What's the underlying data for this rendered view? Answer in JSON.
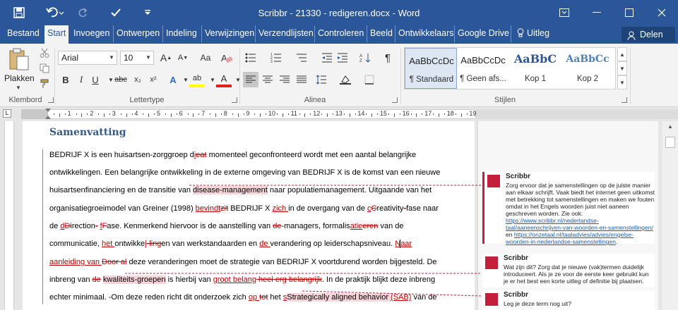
{
  "window": {
    "title": "Scribbr - 21330 - redigeren.docx - Word"
  },
  "tabs": [
    "Bestand",
    "Start",
    "Invoegen",
    "Ontwerpen",
    "Indeling",
    "Verwijzingen",
    "Verzendlijsten",
    "Controleren",
    "Beeld",
    "Ontwikkelaars",
    "Google Drive"
  ],
  "tell_me": "Uitleg",
  "share": "Delen",
  "clipboard": {
    "paste": "Plakken",
    "group": "Klembord"
  },
  "font": {
    "name": "Arial",
    "size": "10",
    "group": "Lettertype",
    "size_up": "A",
    "size_down": "A",
    "case": "Aa",
    "bold": "B",
    "italic": "I",
    "underline": "U",
    "strike": "abc",
    "sub": "x₂",
    "sup": "x²",
    "effects": "A",
    "highlight": "ab",
    "color": "A"
  },
  "paragraph": {
    "group": "Alinea",
    "pilcrow": "¶"
  },
  "styles": {
    "group": "Stijlen",
    "items": [
      {
        "sample": "AaBbCcDc",
        "name": "¶ Standaard"
      },
      {
        "sample": "AaBbCcDc",
        "name": "¶ Geen afs..."
      },
      {
        "sample": "AaBbC",
        "name": "Kop 1"
      },
      {
        "sample": "AaBbCc",
        "name": "Kop 2"
      }
    ]
  },
  "ruler": {
    "labels": [
      "1",
      "2",
      "3",
      "4",
      "5",
      "6",
      "7",
      "8",
      "9",
      "10",
      "11",
      "12",
      "13",
      "14",
      "15",
      "16",
      "17",
      "18",
      "19"
    ]
  },
  "document": {
    "heading": "Samenvatting",
    "lines": [
      [
        {
          "t": "BEDRIJF X is een huisartsen-zorggroep d"
        },
        {
          "t": "i",
          "k": "ins"
        },
        {
          "t": "eat",
          "k": "del"
        },
        {
          "t": " momenteel geconfronteerd wordt met een aantal belangrijke"
        }
      ],
      [
        {
          "t": "ontwikkelingen. Een belangrijke ontwikkeling in de externe omgeving van BEDRIJF X is de komst van een nieuwe"
        }
      ],
      [
        {
          "t": "huisartsenfinanciering en de transitie van "
        },
        {
          "t": "disease-management",
          "k": "hl"
        },
        {
          "t": " naar populatiemanagement. Uitgaande van het"
        }
      ],
      [
        {
          "t": "organisatiegroeimodel van Greiner (1998) "
        },
        {
          "t": "bevindt",
          "k": "ins"
        },
        {
          "t": "zit",
          "k": "del"
        },
        {
          "t": " BEDRIJF X "
        },
        {
          "t": "zich ",
          "k": "ins"
        },
        {
          "t": "in de overgang van de "
        },
        {
          "t": "c",
          "k": "ins"
        },
        {
          "t": "C",
          "k": "del"
        },
        {
          "t": "reativity"
        },
        {
          "t": "-",
          "k": "del"
        },
        {
          "t": "fase naar"
        }
      ],
      [
        {
          "t": "de "
        },
        {
          "t": "d",
          "k": "ins"
        },
        {
          "t": "D",
          "k": "del"
        },
        {
          "t": "irection"
        },
        {
          "t": "-",
          "k": "del"
        },
        {
          "t": " "
        },
        {
          "t": "f",
          "k": "ins"
        },
        {
          "t": "F",
          "k": "del"
        },
        {
          "t": "ase. Kenmerkend hiervoor is de aanstelling van "
        },
        {
          "t": "de",
          "k": "del"
        },
        {
          "t": "-managers, formalis"
        },
        {
          "t": "atie",
          "k": "ins"
        },
        {
          "t": "eren",
          "k": "del"
        },
        {
          "t": " van de"
        }
      ],
      [
        {
          "t": "communicatie, "
        },
        {
          "t": "het ",
          "k": "ins"
        },
        {
          "t": "ontwikke"
        },
        {
          "t": "l",
          "k": "ins"
        },
        {
          "t": "-ling",
          "k": "del"
        },
        {
          "t": "en van werkstandaarden en "
        },
        {
          "t": "de ",
          "k": "ins"
        },
        {
          "t": "verandering op leiderschapsniveau. "
        },
        {
          "t": "Naar",
          "k": "ins"
        }
      ],
      [
        {
          "t": "aanleiding van ",
          "k": "ins"
        },
        {
          "t": "Door al",
          "k": "del"
        },
        {
          "t": " deze veranderingen moet de strategie van BEDRIJF X voortdurend worden bijgesteld. De"
        }
      ],
      [
        {
          "t": "inbreng van "
        },
        {
          "t": "de",
          "k": "del"
        },
        {
          "t": " "
        },
        {
          "t": "kwaliteits-groepen",
          "k": "hl"
        },
        {
          "t": " is hierbij van "
        },
        {
          "t": "groot belang",
          "k": "ins"
        },
        {
          "t": " heel erg belangrijk",
          "k": "del"
        },
        {
          "t": ". In de praktijk blijkt deze inbreng"
        }
      ],
      [
        {
          "t": "echter minimaal. -Om deze reden richt dit onderzoek zich "
        },
        {
          "t": "op ",
          "k": "ins"
        },
        {
          "t": "tot",
          "k": "del"
        },
        {
          "t": " het "
        },
        {
          "t": "s",
          "k": "ins"
        },
        {
          "t": "Strategically aligned behavior ",
          "k": "hl"
        },
        {
          "t": "(SAB)",
          "k": "ins"
        },
        {
          "t": " van de"
        }
      ]
    ]
  },
  "comments": [
    {
      "author": "Scribbr",
      "text": "Zorg ervoor dat je samenstellingen op de juiste manier aan elkaar schrijft. Vaak biedt het internet geen uitkomst met betrekking tot samenstellingen en maken we fouten omdat in het Engels woorden juist niet aaneen geschreven worden. Zie ook: ",
      "link1": "https://www.scribbr.nl/nederlandse-taal/aaneenschrijven-van-woorden-en-samenstellingen/",
      "mid": " en ",
      "link2": "https://onzetaal.nl/taaladvies/advies/engelse-woorden-in-nederlandse-samenstellingen",
      "end": "."
    },
    {
      "author": "Scribbr",
      "text": "Wat zijn dit? Zorg dat je nieuwe (vak)termen duidelijk introduceert. Als je ze voor de eerste keer gebruikt kun je er het best een korte uitleg of definitie bij plaatsen."
    },
    {
      "author": "Scribbr",
      "text": "Leg je deze term nog uit?"
    }
  ]
}
